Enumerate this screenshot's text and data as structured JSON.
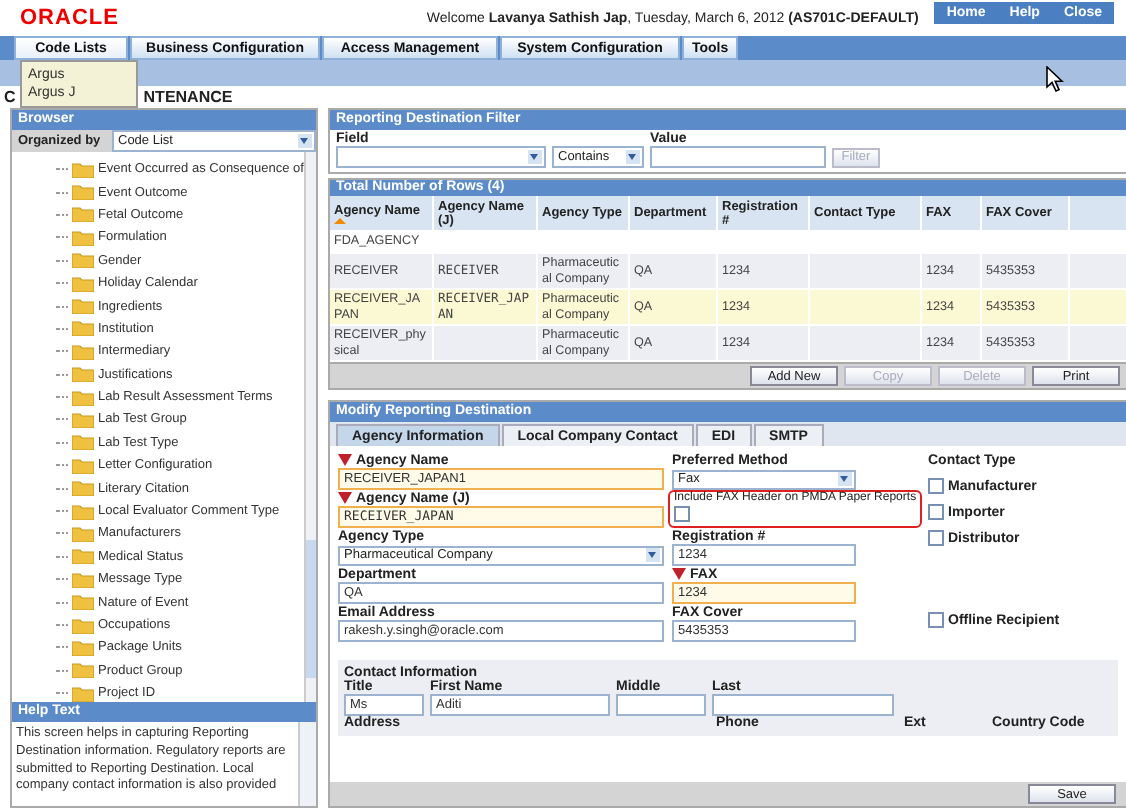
{
  "header": {
    "logo": "ORACLE",
    "welcome": "Welcome **Lavanya Sathish Jap**, Tuesday, March 6, 2012 **(AS701C-DEFAULT)**",
    "links": [
      "Home",
      "Help",
      "Close"
    ]
  },
  "menu": [
    {
      "label": "Code Lists",
      "selected": true
    },
    {
      "label": "Business Configuration",
      "selected": false
    },
    {
      "label": "Access Management",
      "selected": false
    },
    {
      "label": "System Configuration",
      "selected": false
    },
    {
      "label": "Tools",
      "selected": false
    }
  ],
  "dropdown": [
    "Argus",
    "Argus J"
  ],
  "page_title_parts": [
    "C",
    "NTENANCE"
  ],
  "browser": {
    "title": "Browser",
    "organized_by_label": "Organized by",
    "organized_by_value": "Code List",
    "items": [
      "Event Occurred as Consequence of",
      "Event Outcome",
      "Fetal Outcome",
      "Formulation",
      "Gender",
      "Holiday Calendar",
      "Ingredients",
      "Institution",
      "Intermediary",
      "Justifications",
      "Lab Result Assessment Terms",
      "Lab Test Group",
      "Lab Test Type",
      "Letter Configuration",
      "Literary Citation",
      "Local Evaluator Comment Type",
      "Manufacturers",
      "Medical Status",
      "Message Type",
      "Nature of Event",
      "Occupations",
      "Package Units",
      "Product Group",
      "Project ID"
    ]
  },
  "help": {
    "title": "Help Text",
    "text": "This screen helps in capturing Reporting Destination information. Regulatory reports are submitted to Reporting Destination. Local company contact information is also provided"
  },
  "filter": {
    "title": "Reporting Destination Filter",
    "field_label": "Field",
    "operator": "Contains",
    "value_label": "Value",
    "button": "Filter"
  },
  "table": {
    "title": "Total Number of Rows (4)",
    "columns": [
      {
        "label": "Agency Name",
        "sorted": true
      },
      {
        "label": "Agency Name (J)",
        "sorted": false
      },
      {
        "label": "Agency Type",
        "sorted": false
      },
      {
        "label": "Department",
        "sorted": false
      },
      {
        "label": "Registration #",
        "sorted": false
      },
      {
        "label": "Contact Type",
        "sorted": false
      },
      {
        "label": "FAX",
        "sorted": false
      },
      {
        "label": "FAX Cover",
        "sorted": false
      }
    ],
    "rows": [
      {
        "selected": false,
        "cells": [
          "FDA_AGENCY",
          "",
          "",
          "",
          "",
          "",
          "",
          ""
        ]
      },
      {
        "selected": false,
        "cells": [
          "RECEIVER",
          "RECEIVER",
          "Pharmaceutical Company",
          "QA",
          "1234",
          "",
          "1234",
          "5435353"
        ]
      },
      {
        "selected": true,
        "cells": [
          "RECEIVER_JAPAN",
          "RECEIVER_JAPAN",
          "Pharmaceutical Company",
          "QA",
          "1234",
          "",
          "1234",
          "5435353"
        ]
      },
      {
        "selected": false,
        "cells": [
          "RECEIVER_physical",
          "",
          "Pharmaceutical Company",
          "QA",
          "1234",
          "",
          "1234",
          "5435353"
        ]
      }
    ],
    "buttons": [
      {
        "label": "Add New",
        "disabled": false
      },
      {
        "label": "Copy",
        "disabled": true
      },
      {
        "label": "Delete",
        "disabled": true
      },
      {
        "label": "Print",
        "disabled": false
      }
    ]
  },
  "modify": {
    "title": "Modify Reporting Destination",
    "tabs": [
      {
        "label": "Agency Information",
        "selected": true
      },
      {
        "label": "Local Company Contact",
        "selected": false
      },
      {
        "label": "EDI",
        "selected": false
      },
      {
        "label": "SMTP",
        "selected": false
      }
    ],
    "rows": [
      [
        {
          "kind": "text",
          "label": "Agency Name",
          "required": true,
          "value": "RECEIVER_JAPAN1"
        },
        {
          "kind": "select",
          "label": "Preferred Method",
          "required": false,
          "value": "Fax"
        }
      ],
      [
        {
          "kind": "japanese-text",
          "label": "Agency Name (J)",
          "required": true,
          "value": "RECEIVER_JAPAN"
        },
        {
          "kind": "checkbox",
          "label": "Include FAX Header on PMDA Paper Reports",
          "checked": false,
          "highlighted": true
        }
      ],
      [
        {
          "kind": "select",
          "label": "Agency Type",
          "required": false,
          "value": "Pharmaceutical Company"
        },
        {
          "kind": "text",
          "label": "Registration #",
          "required": false,
          "value": "1234"
        }
      ],
      [
        {
          "kind": "text",
          "label": "Department",
          "required": false,
          "value": "QA"
        },
        {
          "kind": "text",
          "label": "FAX",
          "required": true,
          "value": "1234"
        }
      ],
      [
        {
          "kind": "text",
          "label": "Email Address",
          "required": false,
          "value": "rakesh.y.singh@oracle.com"
        },
        {
          "kind": "text",
          "label": "FAX Cover",
          "required": false,
          "value": "5435353"
        }
      ]
    ],
    "contact_type": {
      "label": "Contact Type",
      "options": [
        {
          "label": "Manufacturer",
          "checked": false
        },
        {
          "label": "Importer",
          "checked": false
        },
        {
          "label": "Distributor",
          "checked": false
        }
      ]
    },
    "offline_recipient": {
      "label": "Offline Recipient",
      "checked": false
    },
    "contact_info": {
      "title": "Contact Information",
      "fields": [
        {
          "label": "Title",
          "value": "Ms"
        },
        {
          "label": "First Name",
          "value": "Aditi"
        },
        {
          "label": "Middle"
        },
        {
          "label": "Last"
        }
      ],
      "labels": [
        "Address",
        "Phone",
        "Ext",
        "Country Code"
      ]
    },
    "save": "Save"
  }
}
